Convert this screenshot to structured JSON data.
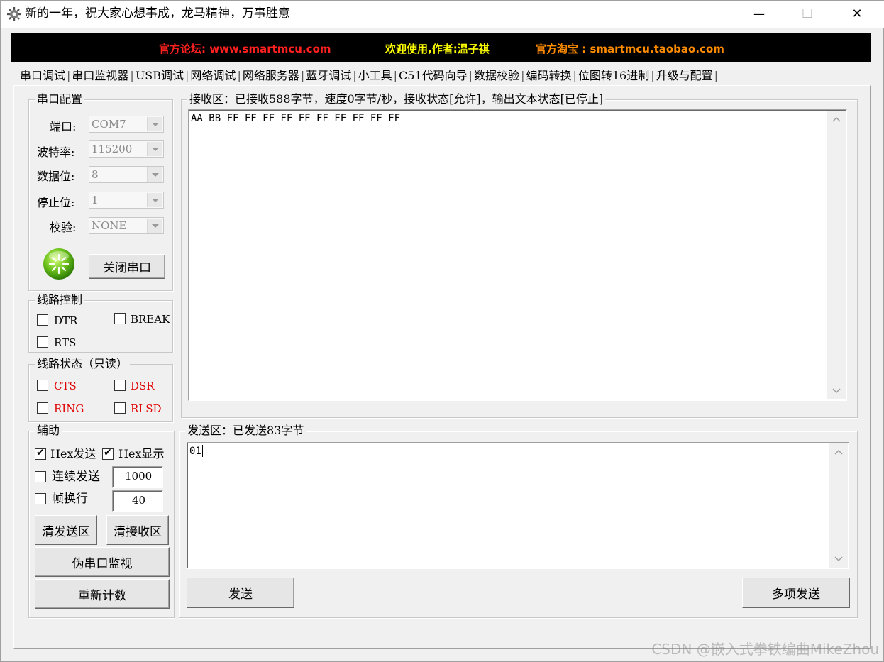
{
  "window": {
    "title": "新的一年，祝大家心想事成，龙马精神，万事胜意",
    "minimize": "—",
    "maximize": "☐",
    "close": "✕"
  },
  "banner": {
    "forum": "官方论坛: www.smartmcu.com",
    "welcome": "欢迎使用,作者:温子祺",
    "shop": "官方淘宝 : smartmcu.taobao.com",
    "colors": {
      "red": "#ff2020",
      "yellow": "#ffff00",
      "orange": "#ff8c00"
    }
  },
  "tabs": [
    "串口调试",
    "串口监视器",
    "USB调试",
    "网络调试",
    "网络服务器",
    "蓝牙调试",
    "小工具",
    "C51代码向导",
    "数据校验",
    "编码转换",
    "位图转16进制",
    "升级与配置"
  ],
  "serial_config": {
    "legend": "串口配置",
    "port_label": "端口:",
    "port_value": "COM7",
    "baud_label": "波特率:",
    "baud_value": "115200",
    "databits_label": "数据位:",
    "databits_value": "8",
    "stopbits_label": "停止位:",
    "stopbits_value": "1",
    "parity_label": "校验:",
    "parity_value": "NONE",
    "close_port_button": "关闭串口"
  },
  "line_control": {
    "legend": "线路控制",
    "dtr": "DTR",
    "break": "BREAK",
    "rts": "RTS"
  },
  "line_status": {
    "legend": "线路状态（只读）",
    "cts": "CTS",
    "dsr": "DSR",
    "ring": "RING",
    "rlsd": "RLSD"
  },
  "assist": {
    "legend": "辅助",
    "hex_send": "Hex发送",
    "hex_display": "Hex显示",
    "continuous_send": "连续发送",
    "continuous_interval": "1000",
    "frame_newline": "帧换行",
    "frame_value": "40",
    "clear_send": "清发送区",
    "clear_receive": "清接收区",
    "fake_monitor": "伪串口监视",
    "recount": "重新计数"
  },
  "receive": {
    "legend": "接收区：已接收588字节，速度0字节/秒，接收状态[允许]，输出文本状态[已停止]",
    "content": "AA BB FF FF FF FF FF FF FF FF FF FF"
  },
  "send": {
    "legend": "发送区：已发送83字节",
    "content": "01",
    "send_button": "发送",
    "multi_send_button": "多项发送"
  },
  "watermark": "CSDN @嵌入式拳铁编曲MikeZhou"
}
